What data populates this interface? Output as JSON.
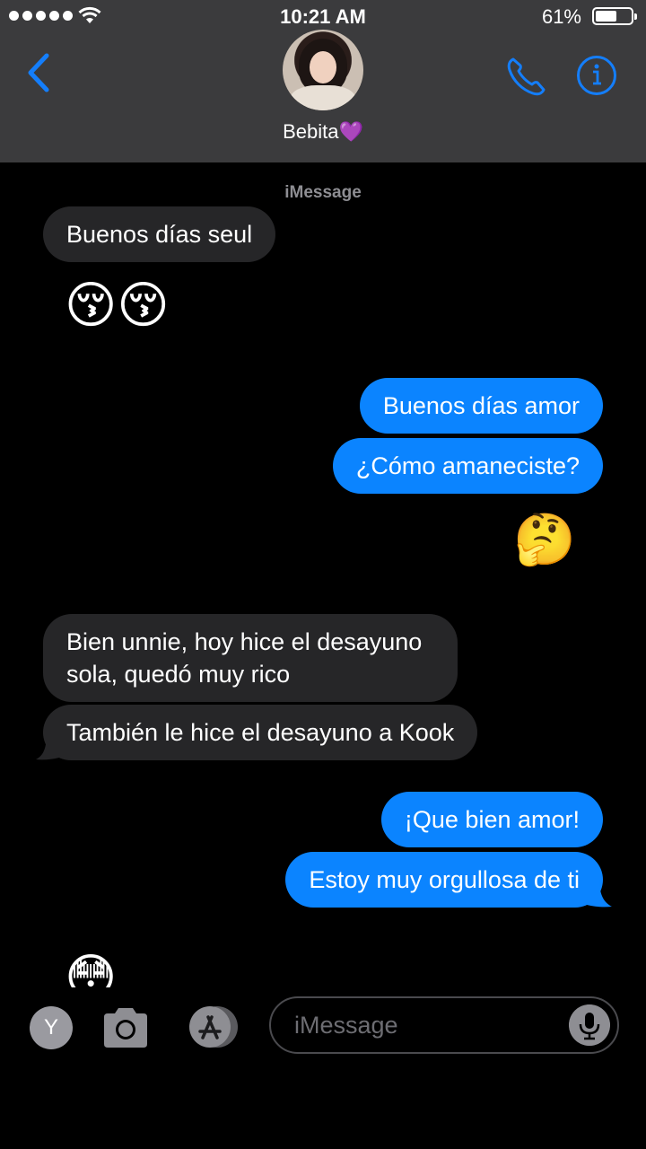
{
  "status_bar": {
    "time": "10:21 AM",
    "battery_percent": "61%",
    "battery_level": 0.61
  },
  "header": {
    "contact_name": "Bebita💜",
    "back_icon": "chevron-left-icon",
    "call_icon": "phone-icon",
    "info_icon": "info-icon"
  },
  "conversation": {
    "service_label": "iMessage",
    "messages": [
      {
        "from": "contact",
        "type": "text",
        "text": "Buenos días seul"
      },
      {
        "from": "contact",
        "type": "emoji",
        "text": "😚😚"
      },
      {
        "from": "me",
        "type": "text",
        "text": "Buenos días amor"
      },
      {
        "from": "me",
        "type": "text",
        "text": "¿Cómo amaneciste?"
      },
      {
        "from": "me",
        "type": "emoji",
        "text": "🤔"
      },
      {
        "from": "contact",
        "type": "text",
        "lines": [
          "Bien unnie, hoy hice el desayuno",
          "sola, quedó muy rico"
        ]
      },
      {
        "from": "contact",
        "type": "text",
        "text": "También le hice el desayuno a Kook"
      },
      {
        "from": "me",
        "type": "text",
        "text": "¡Que bien amor!"
      },
      {
        "from": "me",
        "type": "text",
        "text": "Estoy muy orgullosa de ti"
      },
      {
        "from": "contact",
        "type": "emoji",
        "text": "😳"
      }
    ]
  },
  "input_bar": {
    "app_button_letter": "Y",
    "camera_icon": "camera-icon",
    "appstore_icon": "app-store-icon",
    "placeholder": "iMessage",
    "mic_icon": "microphone-icon"
  },
  "colors": {
    "header_bg": "#3b3b3d",
    "accent_blue": "#0b84ff",
    "received_bubble": "#262628",
    "icon_blue": "#147efb"
  }
}
